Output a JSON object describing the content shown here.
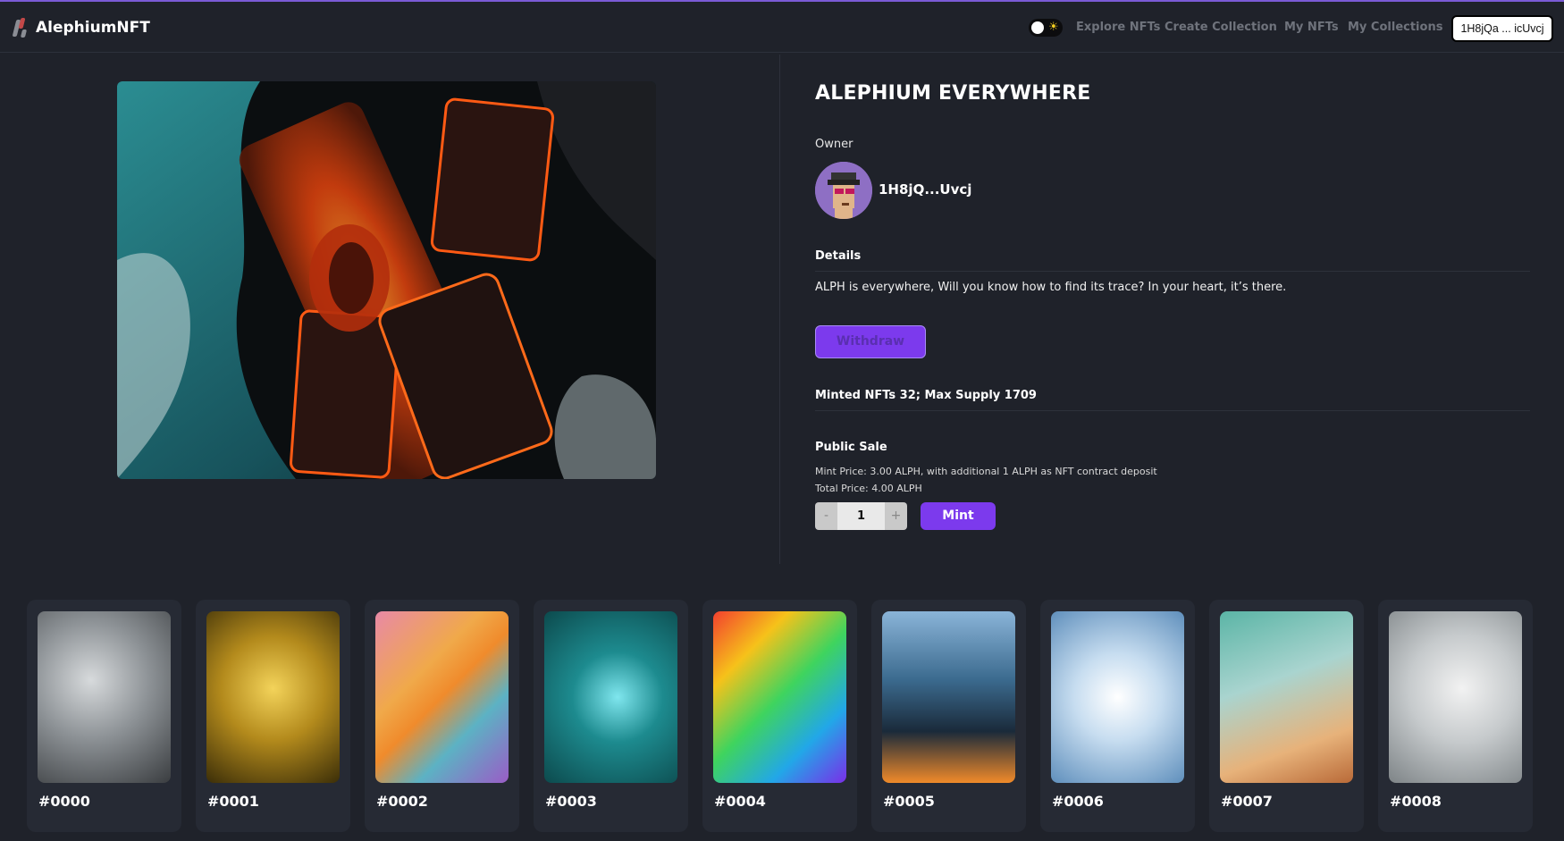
{
  "header": {
    "brand": "AlephiumNFT",
    "nav": [
      "Explore NFTs",
      "Create Collection",
      "My NFTs",
      "My Collections"
    ],
    "wallet": "1H8jQa ... icUvcj"
  },
  "nft": {
    "title": "ALEPHIUM EVERYWHERE",
    "owner_label": "Owner",
    "owner_address": "1H8jQ...Uvcj",
    "details_label": "Details",
    "description": "ALPH is everywhere, Will you know how to find its trace? In your heart, it’s there.",
    "withdraw_label": "Withdraw",
    "minted_info": "Minted NFTs 32; Max Supply 1709",
    "sale_label": "Public Sale",
    "mint_price": "Mint Price: 3.00 ALPH, with additional 1 ALPH as NFT contract deposit",
    "total_price": "Total Price: 4.00 ALPH",
    "quantity": "1",
    "minus": "-",
    "plus": "+",
    "mint_label": "Mint"
  },
  "cards": [
    {
      "label": "#0000",
      "theme": "gray-crystal"
    },
    {
      "label": "#0001",
      "theme": "gold"
    },
    {
      "label": "#0002",
      "theme": "patchwork"
    },
    {
      "label": "#0003",
      "theme": "teal-constellation"
    },
    {
      "label": "#0004",
      "theme": "rainbow"
    },
    {
      "label": "#0005",
      "theme": "city"
    },
    {
      "label": "#0006",
      "theme": "snowflake"
    },
    {
      "label": "#0007",
      "theme": "watercolor"
    },
    {
      "label": "#0008",
      "theme": "origami"
    }
  ],
  "colors": {
    "background": "#1f222a",
    "card": "#262a34",
    "accent": "#7c3aed"
  }
}
